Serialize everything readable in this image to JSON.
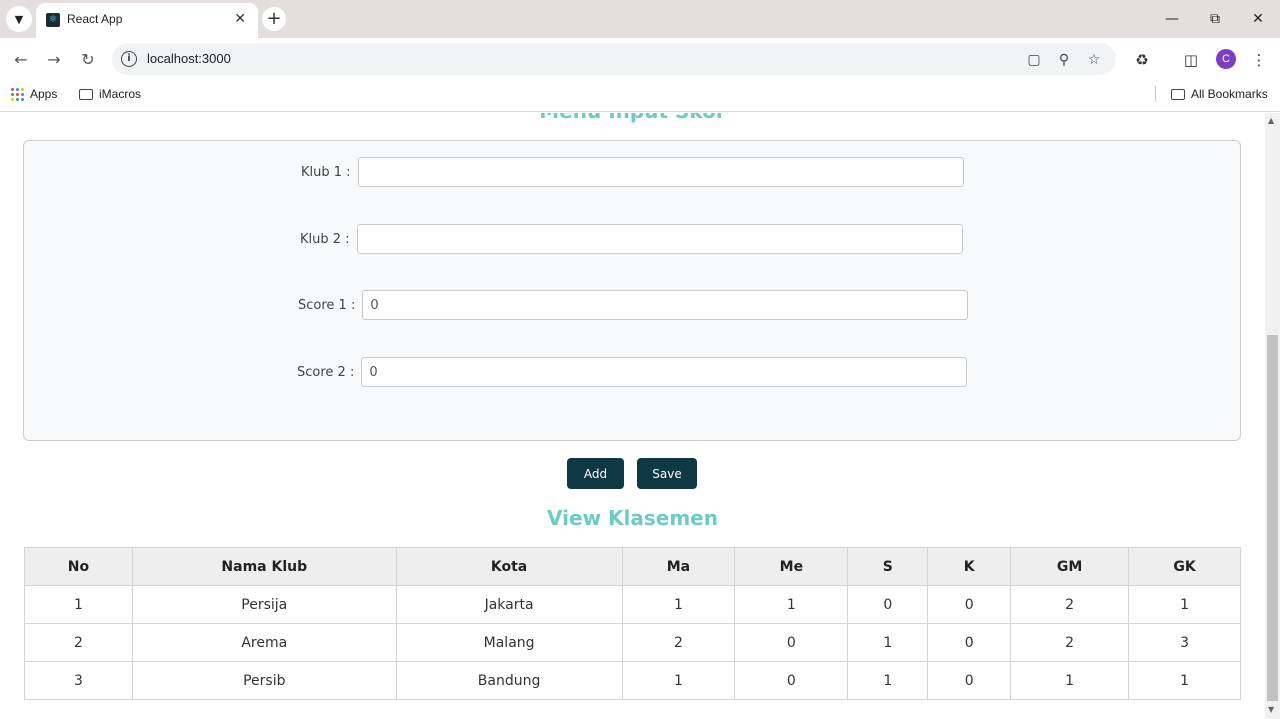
{
  "browser": {
    "tab_title": "React App",
    "url": "localhost:3000",
    "avatar_letter": "C",
    "bookmarks": {
      "apps": "Apps",
      "imacros": "iMacros",
      "all_bookmarks": "All Bookmarks"
    }
  },
  "page": {
    "top_title": "Menu Input Skor",
    "form": {
      "klub1_label": "Klub 1 :",
      "klub1_value": "",
      "klub2_label": "Klub 2 :",
      "klub2_value": "",
      "score1_label": "Score 1 :",
      "score1_value": "0",
      "score2_label": "Score 2 :",
      "score2_value": "0"
    },
    "buttons": {
      "add": "Add",
      "save": "Save"
    },
    "klasemen_title": "View Klasemen",
    "table": {
      "headers": [
        "No",
        "Nama Klub",
        "Kota",
        "Ma",
        "Me",
        "S",
        "K",
        "GM",
        "GK"
      ],
      "rows": [
        [
          "1",
          "Persija",
          "Jakarta",
          "1",
          "1",
          "0",
          "0",
          "2",
          "1"
        ],
        [
          "2",
          "Arema",
          "Malang",
          "2",
          "0",
          "1",
          "0",
          "2",
          "3"
        ],
        [
          "3",
          "Persib",
          "Bandung",
          "1",
          "0",
          "1",
          "0",
          "1",
          "1"
        ]
      ]
    }
  },
  "colors": {
    "accent_title": "#6dcbc3",
    "button_bg": "#0e3844",
    "avatar": "#7b3fc4"
  }
}
